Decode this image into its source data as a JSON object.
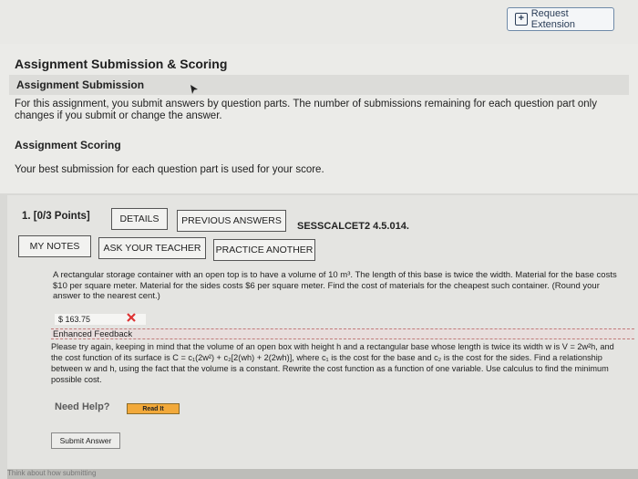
{
  "header": {
    "request_extension": "Request Extension"
  },
  "submission": {
    "title": "Assignment Submission & Scoring",
    "subheading": "Assignment Submission",
    "description": "For this assignment, you submit answers by question parts. The number of submissions remaining for each question part only changes if you submit or change the answer.",
    "scoring_title": "Assignment Scoring",
    "scoring_text": "Your best submission for each question part is used for your score."
  },
  "question": {
    "number": "1. [0/3 Points]",
    "details_label": "DETAILS",
    "previous_answers_label": "PREVIOUS ANSWERS",
    "question_id": "SESSCALCET2 4.5.014.",
    "my_notes_label": "MY NOTES",
    "ask_teacher_label": "ASK YOUR TEACHER",
    "practice_another_label": "PRACTICE ANOTHER",
    "problem_text": "A rectangular storage container with an open top is to have a volume of 10 m³. The length of this base is twice the width. Material for the base costs $10 per square meter. Material for the sides costs $6 per square meter. Find the cost of materials for the cheapest such container. (Round your answer to the nearest cent.)",
    "answer_value": "$ 163.75",
    "feedback_title": "Enhanced Feedback",
    "feedback_text": "Please try again, keeping in mind that the volume of an open box with height h and a rectangular base whose length is twice its width w is V = 2w²h, and the cost function of its surface is C = c₁(2w²) + c₂[2(wh) + 2(2wh)], where c₁ is the cost for the base and c₂ is the cost for the sides. Find a relationship between w and h, using the fact that the volume is a constant. Rewrite the cost function as a function of one variable. Use calculus to find the minimum possible cost.",
    "need_help_label": "Need Help?",
    "read_it_label": "Read It",
    "submit_label": "Submit Answer"
  },
  "footer_partial": "Think about how submitting"
}
